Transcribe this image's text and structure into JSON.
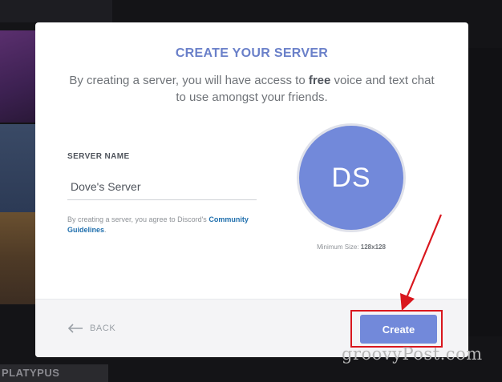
{
  "modal": {
    "title": "CREATE YOUR SERVER",
    "description_before": "By creating a server, you will have access to ",
    "description_bold": "free",
    "description_after": " voice and text chat to use amongst your friends.",
    "field_label": "SERVER NAME",
    "server_name_value": "Dove's Server",
    "agree_text": "By creating a server, you agree to Discord's",
    "agree_link": "Community Guidelines",
    "agree_period": ".",
    "icon_initials": "DS",
    "min_size_label": "Minimum Size: ",
    "min_size_value": "128x128"
  },
  "footer": {
    "back_label": "BACK",
    "create_label": "Create"
  },
  "background": {
    "partial_text": "PLATYPUS"
  },
  "watermark": "groovyPost.com",
  "colors": {
    "accent": "#7289da",
    "title": "#6a80c9",
    "link": "#1f6fad",
    "annotation_red": "#d9171e"
  },
  "icons": [
    "back-arrow-icon",
    "annotation-arrow"
  ]
}
